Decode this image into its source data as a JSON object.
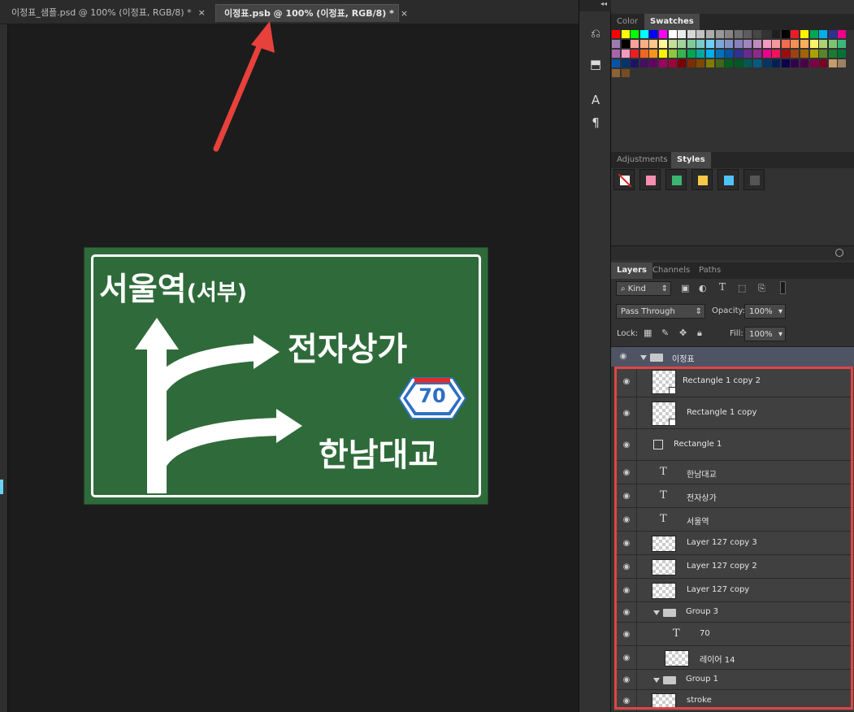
{
  "tabs": [
    {
      "label": "이정표_샘플.psd @ 100% (이정표, RGB/8) *",
      "active": false
    },
    {
      "label": "이정표.psb @ 100% (이정표, RGB/8) *",
      "active": true
    }
  ],
  "tab_close_glyph": "×",
  "dock_collapse_glyph": "◂◂",
  "sign": {
    "line1_main": "서울역",
    "line1_sub": "(서부)",
    "line2": "전자상가",
    "route_number": "70",
    "line3": "한남대교",
    "background_color": "#2f6b3a"
  },
  "color_panel": {
    "tabs": [
      "Color",
      "Swatches"
    ],
    "active_tab": "Swatches"
  },
  "styles_panel": {
    "tabs": [
      "Adjustments",
      "Styles"
    ],
    "active_tab": "Styles",
    "style_colors": [
      "#ffffff",
      "#f48fb1",
      "#3cb371",
      "#f7c948",
      "#4fc3f7",
      "#555555"
    ]
  },
  "layers_panel": {
    "tabs": [
      "Layers",
      "Channels",
      "Paths"
    ],
    "active_tab": "Layers",
    "filter_label": "Kind",
    "blend_mode": "Pass Through",
    "opacity_label": "Opacity:",
    "opacity_value": "100%",
    "lock_label": "Lock:",
    "fill_label": "Fill:",
    "fill_value": "100%",
    "group_name": "이정표",
    "layers": [
      {
        "name": "Rectangle 1 copy 2",
        "kind": "shape"
      },
      {
        "name": "Rectangle 1 copy",
        "kind": "shape"
      },
      {
        "name": "Rectangle 1",
        "kind": "shape-small"
      },
      {
        "name": "한남대교",
        "kind": "text"
      },
      {
        "name": "전자상가",
        "kind": "text"
      },
      {
        "name": "서울역",
        "kind": "text"
      },
      {
        "name": "Layer 127 copy 3",
        "kind": "pixel"
      },
      {
        "name": "Layer 127 copy 2",
        "kind": "pixel"
      },
      {
        "name": "Layer 127 copy",
        "kind": "pixel"
      },
      {
        "name": "Group 3",
        "kind": "group"
      },
      {
        "name": "70",
        "kind": "text-nested"
      },
      {
        "name": "레이어 14",
        "kind": "pixel-nested"
      },
      {
        "name": "Group 1",
        "kind": "group"
      },
      {
        "name": "stroke",
        "kind": "pixel"
      }
    ]
  },
  "colors": {
    "annotation_red": "#e8413b",
    "panel_bg": "#323232",
    "sign_green": "#2f6b3a"
  }
}
